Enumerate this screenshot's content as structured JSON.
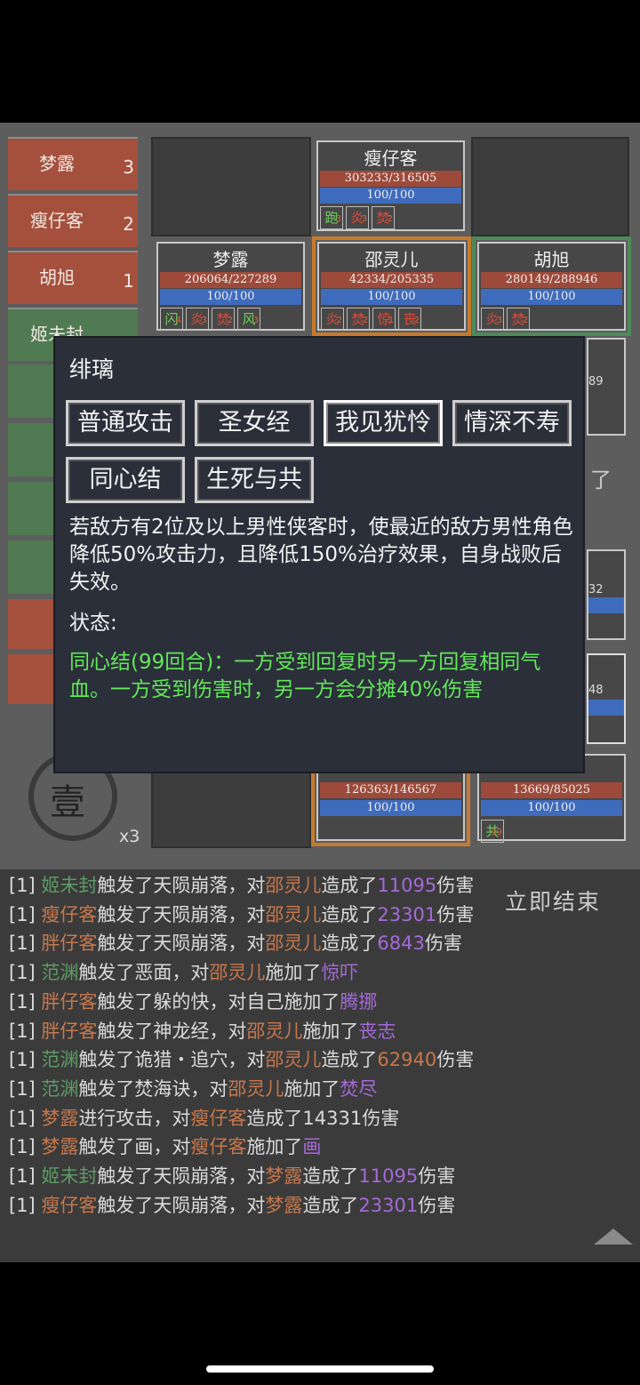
{
  "turn_order": [
    {
      "name": "梦露",
      "num": "3",
      "side": "red"
    },
    {
      "name": "瘦仔客",
      "num": "2",
      "side": "red"
    },
    {
      "name": "胡旭",
      "num": "1",
      "side": "red"
    },
    {
      "name": "姬未封",
      "num": "",
      "side": "green"
    }
  ],
  "grid": {
    "top_card": {
      "name": "瘦仔客",
      "hp": "303233/316505",
      "mp": "100/100",
      "buffs": [
        {
          "t": "跑",
          "n": "3",
          "g": true
        },
        {
          "t": "炎",
          "n": "3"
        },
        {
          "t": "焚",
          "n": "2"
        }
      ]
    },
    "row2": [
      {
        "name": "梦露",
        "hp": "206064/227289",
        "mp": "100/100",
        "buffs": [
          {
            "t": "闪",
            "n": "4",
            "g": true
          },
          {
            "t": "炎",
            "n": "3"
          },
          {
            "t": "焚",
            "n": "2"
          },
          {
            "t": "风",
            "n": "3",
            "g": true
          }
        ]
      },
      {
        "name": "邵灵儿",
        "hp": "42334/205335",
        "mp": "100/100",
        "buffs": [
          {
            "t": "炎",
            "n": "2"
          },
          {
            "t": "焚",
            "n": "2"
          },
          {
            "t": "惊",
            "n": "1"
          },
          {
            "t": "丧",
            "n": "2"
          }
        ]
      },
      {
        "name": "胡旭",
        "hp": "280149/288946",
        "mp": "100/100",
        "buffs": [
          {
            "t": "炎",
            "n": "3"
          },
          {
            "t": "焚",
            "n": "2"
          }
        ]
      }
    ],
    "bottom_cards": [
      {
        "hp": "126363/146567",
        "mp": "100/100"
      },
      {
        "hp": "13669/85025",
        "mp": "100/100",
        "buff": "共",
        "buff_n": "99"
      }
    ],
    "partial_texts": [
      "89",
      "32",
      "48",
      "了"
    ],
    "seal_char": "壹",
    "multiplier": "x3"
  },
  "popup": {
    "title": "绯璃",
    "skills": [
      "普通攻击",
      "圣女经",
      "我见犹怜",
      "情深不寿",
      "同心结",
      "生死与共"
    ],
    "selected_index": 2,
    "description": "若敌方有2位及以上男性侠客时，使最近的敌方男性角色降低50%攻击力，且降低150%治疗效果，自身战败后失效。",
    "status_label": "状态:",
    "status_text": "同心结(99回合)：一方受到回复时另一方回复相同气血。一方受到伤害时，另一方会分摊40%伤害"
  },
  "end_button": "立即结束",
  "log": [
    [
      [
        "[1] ",
        ""
      ],
      [
        "姬未封",
        "g"
      ],
      [
        "触发了天陨崩落，对",
        ""
      ],
      [
        "邵灵儿",
        "o"
      ],
      [
        "造成了",
        ""
      ],
      [
        "11095",
        "p"
      ],
      [
        "伤害",
        ""
      ]
    ],
    [
      [
        "[1] ",
        ""
      ],
      [
        "瘦仔客",
        "o"
      ],
      [
        "触发了天陨崩落，对",
        ""
      ],
      [
        "邵灵儿",
        "o"
      ],
      [
        "造成了",
        ""
      ],
      [
        "23301",
        "p"
      ],
      [
        "伤害",
        ""
      ]
    ],
    [
      [
        "[1] ",
        ""
      ],
      [
        "胖仔客",
        "o"
      ],
      [
        "触发了天陨崩落，对",
        ""
      ],
      [
        "邵灵儿",
        "o"
      ],
      [
        "造成了",
        ""
      ],
      [
        "6843",
        "p"
      ],
      [
        "伤害",
        ""
      ]
    ],
    [
      [
        "[1] ",
        ""
      ],
      [
        "范渊",
        "g"
      ],
      [
        "触发了恶面，对",
        ""
      ],
      [
        "邵灵儿",
        "o"
      ],
      [
        "施加了",
        ""
      ],
      [
        "惊吓",
        "p"
      ]
    ],
    [
      [
        "[1] ",
        ""
      ],
      [
        "胖仔客",
        "o"
      ],
      [
        "触发了躲的快，对自己施加了",
        ""
      ],
      [
        "腾挪",
        "p"
      ]
    ],
    [
      [
        "[1] ",
        ""
      ],
      [
        "胖仔客",
        "o"
      ],
      [
        "触发了神龙经，对",
        ""
      ],
      [
        "邵灵儿",
        "o"
      ],
      [
        "施加了",
        ""
      ],
      [
        "丧志",
        "p"
      ]
    ],
    [
      [
        "[1] ",
        ""
      ],
      [
        "范渊",
        "g"
      ],
      [
        "触发了诡猎・追穴，对",
        ""
      ],
      [
        "邵灵儿",
        "o"
      ],
      [
        "造成了",
        ""
      ],
      [
        "62940",
        "o"
      ],
      [
        "伤害",
        ""
      ]
    ],
    [
      [
        "[1] ",
        ""
      ],
      [
        "范渊",
        "g"
      ],
      [
        "触发了焚海诀，对",
        ""
      ],
      [
        "邵灵儿",
        "o"
      ],
      [
        "施加了",
        ""
      ],
      [
        "焚尽",
        "p"
      ]
    ],
    [
      [
        "[1] ",
        ""
      ],
      [
        "梦露",
        "o"
      ],
      [
        "进行攻击，对",
        ""
      ],
      [
        "瘦仔客",
        "o"
      ],
      [
        "造成了14331伤害",
        ""
      ]
    ],
    [
      [
        "[1] ",
        ""
      ],
      [
        "梦露",
        "o"
      ],
      [
        "触发了画，对",
        ""
      ],
      [
        "瘦仔客",
        "o"
      ],
      [
        "施加了",
        ""
      ],
      [
        "画",
        "p"
      ]
    ],
    [
      [
        "[1] ",
        ""
      ],
      [
        "姬未封",
        "g"
      ],
      [
        "触发了天陨崩落，对",
        ""
      ],
      [
        "梦露",
        "o"
      ],
      [
        "造成了",
        ""
      ],
      [
        "11095",
        "p"
      ],
      [
        "伤害",
        ""
      ]
    ],
    [
      [
        "[1] ",
        ""
      ],
      [
        "瘦仔客",
        "o"
      ],
      [
        "触发了天陨崩落，对",
        ""
      ],
      [
        "梦露",
        "o"
      ],
      [
        "造成了",
        ""
      ],
      [
        "23301",
        "p"
      ],
      [
        "伤害",
        ""
      ]
    ]
  ]
}
